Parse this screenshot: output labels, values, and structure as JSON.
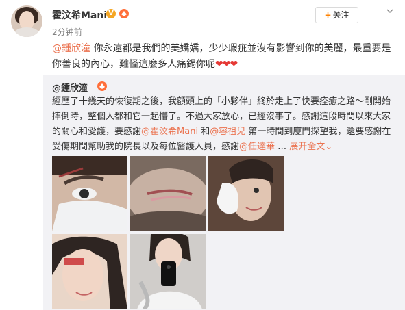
{
  "post": {
    "username": "霍汶希Mani",
    "verified_icon": "v-badge-icon",
    "fan_icon": "fan-badge-icon",
    "time": "2分钟前",
    "follow_label": "关注",
    "menu_icon": "chevron-down-icon",
    "mention": "@鍾欣潼",
    "text": " 你永遠都是我們的美嬌嬌，少少瑕疵並沒有影響到你的美麗，最重要是你善良的內心，難怪這麼多人痛錫你呢",
    "hearts": "❤❤❤"
  },
  "repost": {
    "username": "@鍾欣潼",
    "text_1": "經歷了十幾天的恢復期之後，我額頭上的「小夥伴」終於走上了快要痊癒之路～剛開始摔倒時，整個人都和它一起懵了。不過大家放心，已經沒事了。感謝這段時間以來大家的關心和愛護，要感謝",
    "mention_1": "@霍汶希Mani",
    "text_2": " 和",
    "mention_2": "@容祖兒",
    "text_3": " 第一時間到廈門探望我，還要感謝在受傷期間幫助我的院長以及每位醫護人員，感謝",
    "mention_3": "@任達華",
    "text_4": " … ",
    "expand_label": "展开全文",
    "expand_icon": "chevron-down-icon",
    "photos": [
      "photo-1",
      "photo-2",
      "photo-3",
      "photo-4",
      "photo-5"
    ]
  }
}
